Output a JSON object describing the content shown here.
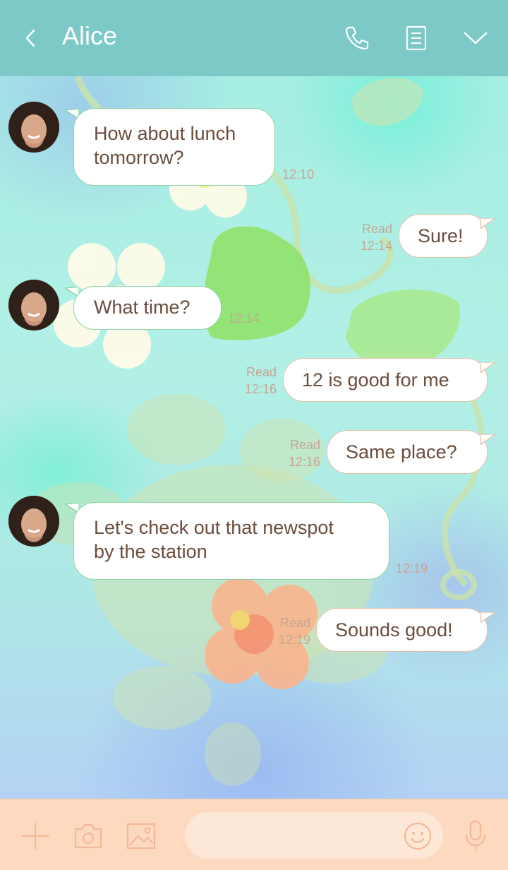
{
  "header": {
    "back_icon": "chevron-left-icon",
    "title": "Alice",
    "actions": [
      "phone-icon",
      "notes-icon",
      "chevron-down-icon"
    ]
  },
  "messages": [
    {
      "side": "in",
      "text_lines": [
        "How about lunch",
        "tomorrow?"
      ],
      "time": "12:10"
    },
    {
      "side": "out",
      "text": "Sure!",
      "read": "Read",
      "time": "12:14"
    },
    {
      "side": "in",
      "text": "What time?",
      "time": "12:14"
    },
    {
      "side": "out",
      "text": "12 is good for me",
      "read": "Read",
      "time": "12:16"
    },
    {
      "side": "out",
      "text": "Same place?",
      "read": "Read",
      "time": "12:16"
    },
    {
      "side": "in",
      "text_lines": [
        "Let's check out that newspot",
        "by the station"
      ],
      "time": "12:19"
    },
    {
      "side": "out",
      "text": "Sounds good!",
      "read": "Read",
      "time": "12:19"
    }
  ],
  "footer": {
    "icons": [
      "plus-icon",
      "camera-icon",
      "image-icon",
      "emoji-icon",
      "microphone-icon"
    ],
    "input_value": "",
    "input_placeholder": ""
  },
  "colors": {
    "header_bg": "#7cc9c7",
    "footer_bg": "#fdd9bf",
    "text": "#6b4d3c",
    "meta": "#c8a595",
    "bubble_in_border": "#8fd4a8",
    "bubble_out_border": "#e6c3ae"
  }
}
